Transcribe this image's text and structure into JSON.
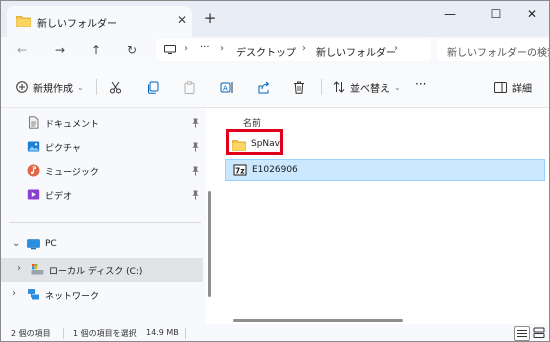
{
  "window": {
    "tab_title": "新しいフォルダー",
    "new_tab": "+",
    "close_tab": "✕",
    "controls": {
      "minimize": "—",
      "maximize": "☐",
      "close": "✕"
    }
  },
  "nav": {
    "back": "←",
    "forward": "→",
    "up": "↑",
    "refresh": "↻",
    "more": "···",
    "breadcrumb": [
      "デスクトップ",
      "新しいフォルダー"
    ],
    "search_placeholder": "新しいフォルダーの検索"
  },
  "toolbar": {
    "new_label": "新規作成",
    "sort_label": "並べ替え",
    "more": "···",
    "details_label": "詳細"
  },
  "sidebar": {
    "quick_access": [
      {
        "label": "ドキュメント",
        "icon": "document-icon"
      },
      {
        "label": "ピクチャ",
        "icon": "pictures-icon"
      },
      {
        "label": "ミュージック",
        "icon": "music-icon"
      },
      {
        "label": "ビデオ",
        "icon": "videos-icon"
      }
    ],
    "pc_label": "PC",
    "local_disk_label": "ローカル ディスク (C:)",
    "network_label": "ネットワーク"
  },
  "content": {
    "column_name": "名前",
    "files": [
      {
        "name": "SpNavi",
        "type": "folder",
        "highlighted": true
      },
      {
        "name": "E1026906",
        "type": "7z-archive",
        "selected": true
      }
    ]
  },
  "status": {
    "item_count": "2 個の項目",
    "selection": "1 個の項目を選択",
    "size": "14.9 MB"
  },
  "colors": {
    "folder_yellow": "#f5c542",
    "accent_blue": "#0067c0",
    "selection_bg": "#cce8ff",
    "highlight_red": "#e0001b"
  }
}
